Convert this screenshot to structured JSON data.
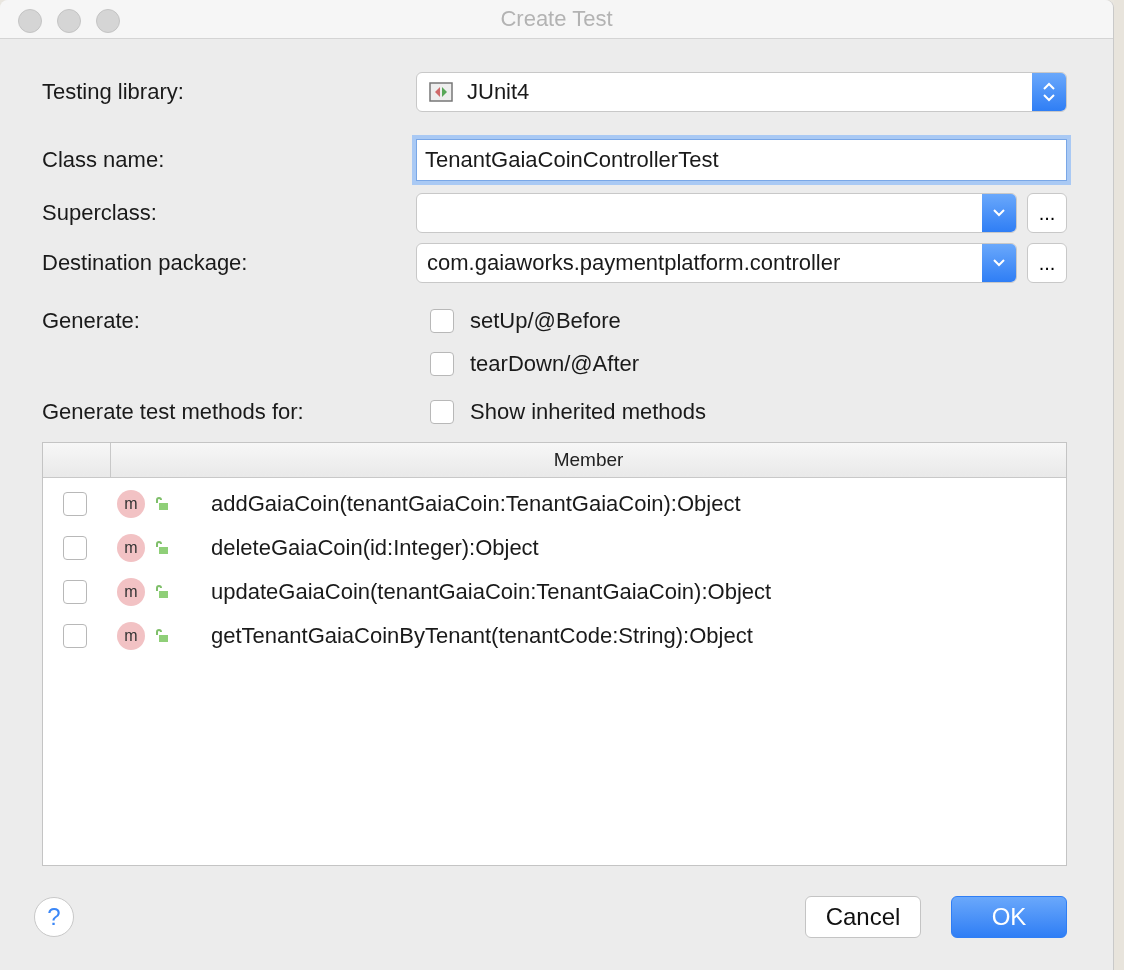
{
  "window": {
    "title": "Create Test"
  },
  "fields": [
    {
      "kind": "stepper",
      "label": "Testing library:",
      "value": "JUnit4"
    },
    {
      "kind": "input",
      "label": "Class name:",
      "value": "TenantGaiaCoinControllerTest",
      "focused": true
    },
    {
      "kind": "combo",
      "label": "Superclass:",
      "browse": "..."
    },
    {
      "kind": "combo",
      "label": "Destination package:",
      "value": "com.gaiaworks.paymentplatform.controller",
      "browse": "..."
    }
  ],
  "generate": {
    "label": "Generate:",
    "options": [
      {
        "label": "setUp/@Before",
        "checked": false
      },
      {
        "label": "tearDown/@After",
        "checked": false
      }
    ]
  },
  "methods": {
    "label": "Generate test methods for:",
    "show_inherited": {
      "label": "Show inherited methods",
      "checked": false
    }
  },
  "table": {
    "columns": [
      "Member"
    ],
    "rows": [
      {
        "checked": false,
        "badge": "m",
        "signature": "addGaiaCoin(tenantGaiaCoin:TenantGaiaCoin):Object"
      },
      {
        "checked": false,
        "badge": "m",
        "signature": "deleteGaiaCoin(id:Integer):Object"
      },
      {
        "checked": false,
        "badge": "m",
        "signature": "updateGaiaCoin(tenantGaiaCoin:TenantGaiaCoin):Object"
      },
      {
        "checked": false,
        "badge": "m",
        "signature": "getTenantGaiaCoinByTenant(tenantCode:String):Object"
      }
    ]
  },
  "help": "?",
  "buttons": [
    {
      "label": "Cancel",
      "kind": "normal"
    },
    {
      "label": "OK",
      "kind": "default"
    }
  ]
}
